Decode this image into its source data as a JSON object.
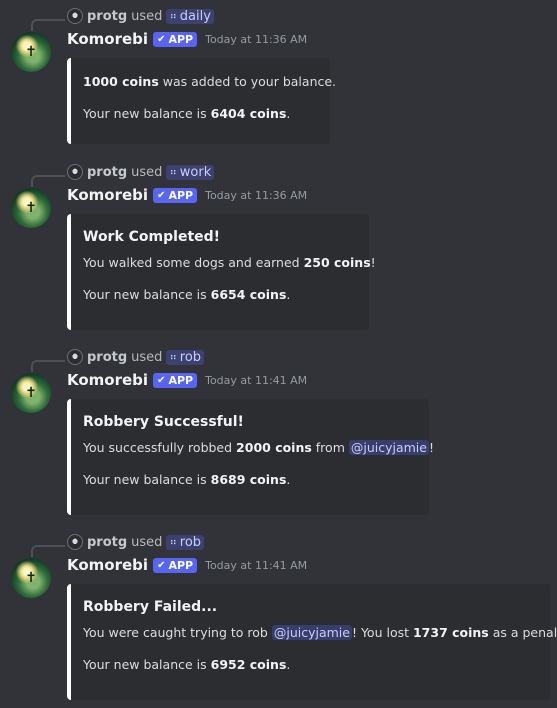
{
  "messages": [
    {
      "reply_user": "protg",
      "reply_used": "used",
      "command": "daily",
      "username": "Komorebi",
      "badge": "APP",
      "timestamp": "Today at 11:36 AM",
      "embed": {
        "title": "",
        "line1_bold": "1000 coins",
        "line1_rest": " was added to your balance.",
        "balance_prefix": "Your new balance is ",
        "balance_value": "6404 coins",
        "balance_suffix": "."
      }
    },
    {
      "reply_user": "protg",
      "reply_used": "used",
      "command": "work",
      "username": "Komorebi",
      "badge": "APP",
      "timestamp": "Today at 11:36 AM",
      "embed": {
        "title": "Work Completed!",
        "line1_a": "You walked some dogs and earned ",
        "line1_bold": "250 coins",
        "line1_b": "!",
        "balance_prefix": "Your new balance is ",
        "balance_value": "6654 coins",
        "balance_suffix": "."
      }
    },
    {
      "reply_user": "protg",
      "reply_used": "used",
      "command": "rob",
      "username": "Komorebi",
      "badge": "APP",
      "timestamp": "Today at 11:41 AM",
      "embed": {
        "title": "Robbery Successful!",
        "line1_a": "You successfully robbed ",
        "line1_bold": "2000 coins",
        "line1_b": " from ",
        "mention": "@juicyjamie",
        "line1_c": "!",
        "balance_prefix": "Your new balance is ",
        "balance_value": "8689 coins",
        "balance_suffix": "."
      }
    },
    {
      "reply_user": "protg",
      "reply_used": "used",
      "command": "rob",
      "username": "Komorebi",
      "badge": "APP",
      "timestamp": "Today at 11:41 AM",
      "embed": {
        "title": "Robbery Failed...",
        "line1_a": "You were caught trying to rob ",
        "mention": "@juicyjamie",
        "line1_b": "! You lost ",
        "line1_bold": "1737 coins",
        "line1_c": " as a penalty.",
        "balance_prefix": "Your new balance is ",
        "balance_value": "6952 coins",
        "balance_suffix": "."
      }
    }
  ],
  "icons": {
    "command": "slash-command-icon",
    "verified": "checkmark-icon",
    "avatar": "komorebi-avatar"
  },
  "colors": {
    "background": "#313338",
    "embed_background": "#2b2d31",
    "embed_border": "#ffffff",
    "app_badge": "#5865f2",
    "mention": "#c9cdfb"
  }
}
